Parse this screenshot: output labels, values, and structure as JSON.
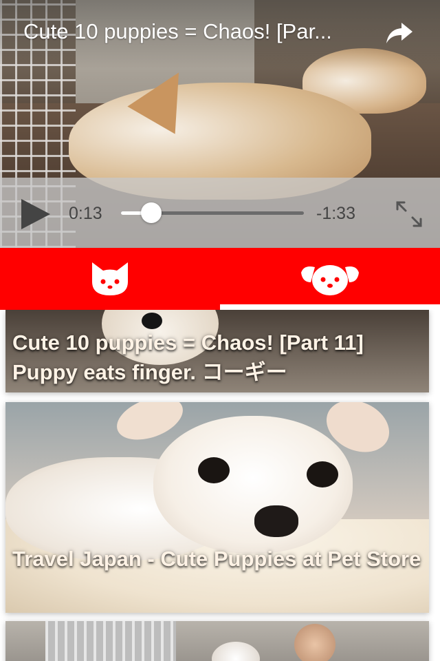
{
  "player": {
    "title": "Cute 10 puppies = Chaos! [Par...",
    "share_icon": "share-arrow-icon",
    "play_icon": "play-icon",
    "fullscreen_icon": "fullscreen-expand-icon",
    "time_elapsed": "0:13",
    "time_remaining": "-1:33",
    "progress": 0.165
  },
  "tabs": [
    {
      "icon": "cat-face-icon",
      "selected": false
    },
    {
      "icon": "dog-face-icon",
      "selected": true
    }
  ],
  "feed": {
    "items": [
      {
        "title": "Cute 10 puppies = Chaos! [Part 11] Puppy eats finger. コーギー"
      },
      {
        "title": "Travel Japan - Cute Puppies at Pet Store"
      },
      {
        "title": ""
      }
    ]
  },
  "colors": {
    "tab_bar": "#ff0000",
    "tab_indicator": "#ffffff",
    "card_title": "#fff3e6"
  }
}
